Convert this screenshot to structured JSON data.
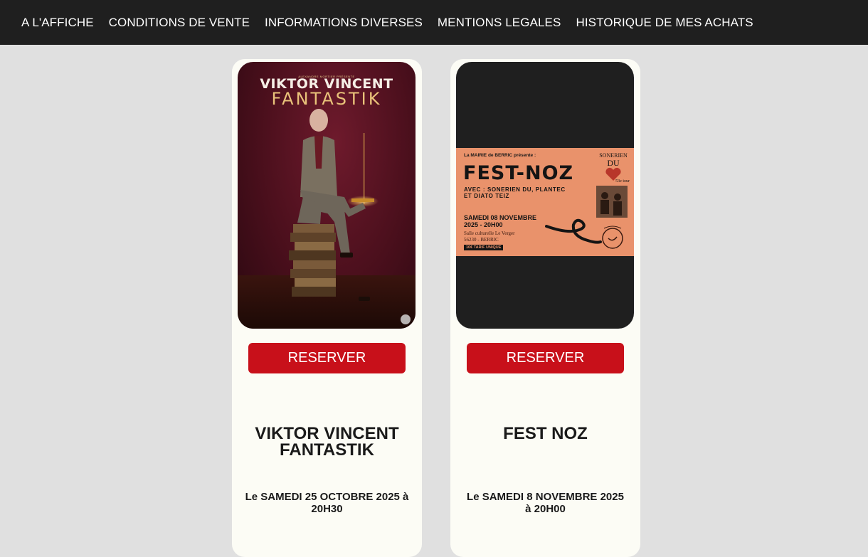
{
  "nav": {
    "items": [
      "A L'AFFICHE",
      "CONDITIONS DE VENTE",
      "INFORMATIONS DIVERSES",
      "MENTIONS LEGALES",
      "HISTORIQUE DE MES ACHATS"
    ]
  },
  "events": [
    {
      "poster": {
        "presenter": "ALEXANDRE MORTIER PRÉSENTE",
        "name": "VIKTOR VINCENT",
        "show": "FANTASTIK"
      },
      "button": "RESERVER",
      "title": "VIKTOR VINCENT FANTASTIK",
      "date": "Le SAMEDI 25 OCTOBRE 2025 à 20H30"
    },
    {
      "poster": {
        "intro": "La MAIRIE de BERRIC présente :",
        "title": "FEST-NOZ",
        "avec_line1": "AVEC : SONERIEN DU, PLANTEC",
        "avec_line2": "ET DIATO TEIZ",
        "date_line1": "SAMEDI 08 NOVEMBRE",
        "date_line2": "2025 - 20H00",
        "place_line1": "Salle culturelle Le Verger",
        "place_line2": "56230 - BERRIC",
        "tarif": "10€ TARIF UNIQUE",
        "band_line1": "SONERIEN",
        "band_line2": "DU",
        "band_tour": "53e tour"
      },
      "button": "RESERVER",
      "title": "FEST NOZ",
      "date": "Le SAMEDI 8 NOVEMBRE 2025 à 20H00"
    }
  ],
  "colors": {
    "navbar": "#1f1f1f",
    "page_bg": "#e0e0e0",
    "card_bg": "#fcfcf5",
    "button": "#c8101a",
    "flyer": "#e9926b"
  }
}
